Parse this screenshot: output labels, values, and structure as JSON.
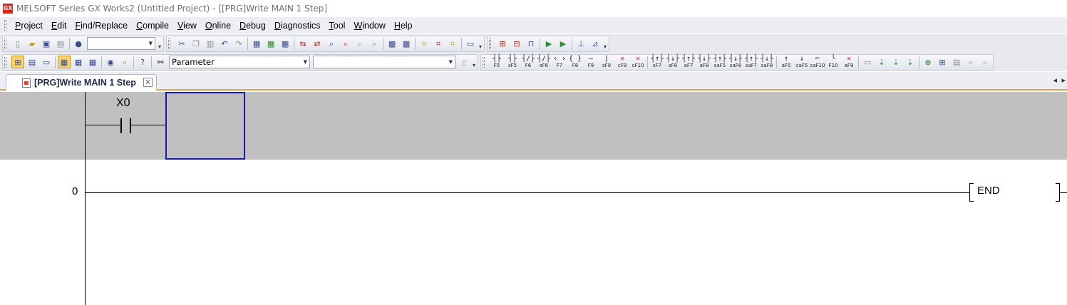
{
  "window": {
    "icon_text": "GX",
    "title": "MELSOFT Series GX Works2 (Untitled Project) - [[PRG]Write MAIN 1 Step]"
  },
  "menu": [
    "Project",
    "Edit",
    "Find/Replace",
    "Compile",
    "View",
    "Online",
    "Debug",
    "Diagnostics",
    "Tool",
    "Window",
    "Help"
  ],
  "toolbar2": {
    "parameter_combo": "Parameter",
    "second_combo": ""
  },
  "fkeys": [
    {
      "sym": "┤├",
      "label": "F5"
    },
    {
      "sym": "┤├",
      "label": "sF5"
    },
    {
      "sym": "┤/├",
      "label": "F6"
    },
    {
      "sym": "┤/├",
      "label": "sF6"
    },
    {
      "sym": "‹ ›",
      "label": "F7"
    },
    {
      "sym": "{ }",
      "label": "F8"
    },
    {
      "sym": "—",
      "label": "F9"
    },
    {
      "sym": "|",
      "label": "sF9"
    },
    {
      "sym": "✕",
      "label": "cF9",
      "red": true
    },
    {
      "sym": "✕",
      "label": "cF10",
      "red": true
    },
    {
      "sym": "┤↑├",
      "label": "sF7"
    },
    {
      "sym": "┤↓├",
      "label": "sF8"
    },
    {
      "sym": "┤↑├",
      "label": "aF7"
    },
    {
      "sym": "┤↓├",
      "label": "aF8"
    },
    {
      "sym": "┤↑├",
      "label": "saF5"
    },
    {
      "sym": "┤↓├",
      "label": "saF6"
    },
    {
      "sym": "┤↑├",
      "label": "saF7"
    },
    {
      "sym": "┤↓├",
      "label": "saF8"
    },
    {
      "sym": "↑",
      "label": "aF5"
    },
    {
      "sym": "↓",
      "label": "caF5"
    },
    {
      "sym": "⌐",
      "label": "caF10"
    },
    {
      "sym": "└",
      "label": "F10"
    },
    {
      "sym": "✕",
      "label": "aF9",
      "red": true
    }
  ],
  "tab": {
    "label": "[PRG]Write MAIN 1 Step",
    "close": "×",
    "scroll_left": "◂",
    "scroll_right": "▸"
  },
  "ladder": {
    "contact_device": "X0",
    "end_step": "0",
    "end_instruction": "END"
  },
  "colors": {
    "edit_band": "#c0c0c0",
    "cursor": "#1a1aa8",
    "tab_accent": "#e0a050"
  }
}
